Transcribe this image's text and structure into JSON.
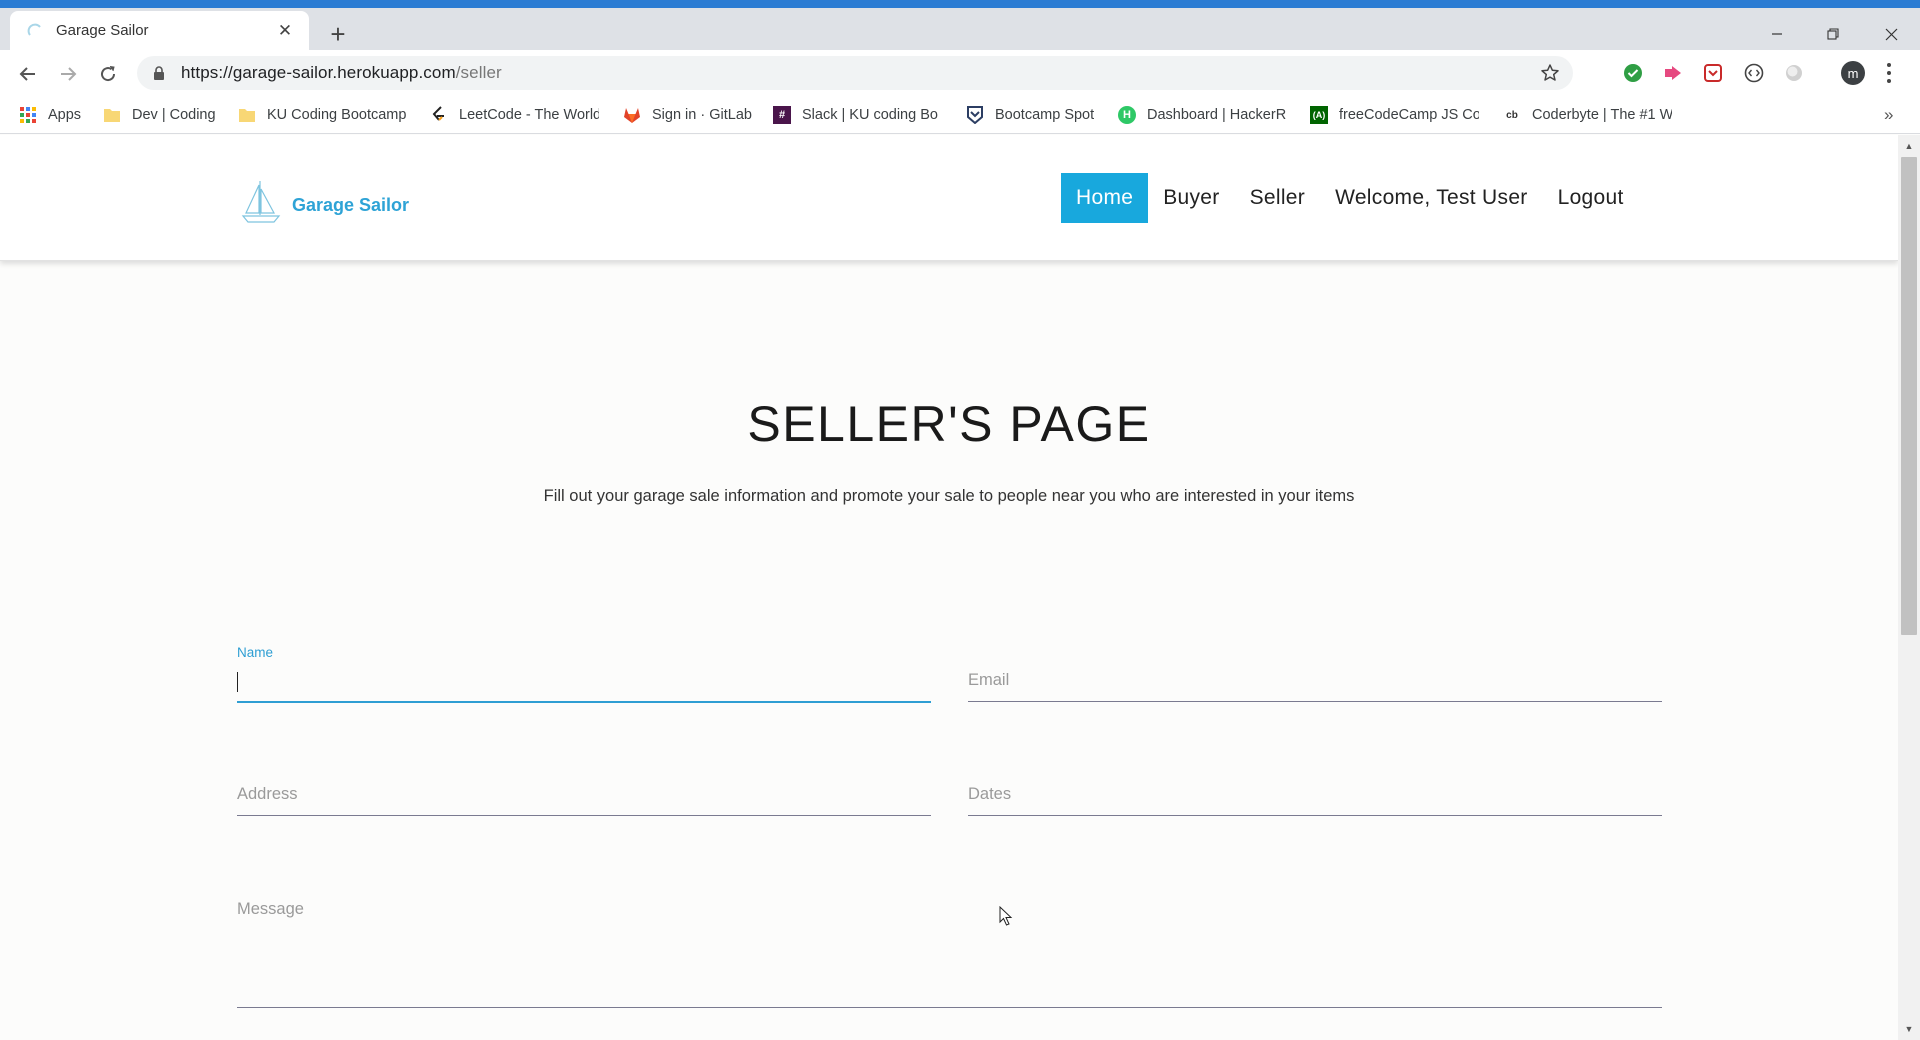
{
  "browser": {
    "tab_title": "Garage Sailor",
    "new_tab_symbol": "+",
    "close_symbol": "✕",
    "url_host": "https://garage-sailor.herokuapp.com",
    "url_path": "/seller",
    "profile_initial": "m",
    "bookmarks": [
      {
        "label": "Apps",
        "icon": "apps-grid-icon"
      },
      {
        "label": "Dev | Coding",
        "icon": "folder-icon"
      },
      {
        "label": "KU Coding Bootcamp",
        "icon": "folder-icon"
      },
      {
        "label": "LeetCode - The World",
        "icon": "leetcode-icon"
      },
      {
        "label": "Sign in · GitLab",
        "icon": "gitlab-icon"
      },
      {
        "label": "Slack | KU coding Bo",
        "icon": "slack-icon"
      },
      {
        "label": "Bootcamp Spot",
        "icon": "bootcamp-spot-icon"
      },
      {
        "label": "Dashboard | HackerR",
        "icon": "hackerrank-icon"
      },
      {
        "label": "freeCodeCamp JS Co",
        "icon": "freecodecamp-icon"
      },
      {
        "label": "Coderbyte | The #1 W",
        "icon": "coderbyte-icon"
      }
    ],
    "more_bookmarks_symbol": "»"
  },
  "site": {
    "brand_name": "Garage Sailor",
    "nav": [
      {
        "label": "Home",
        "active": true
      },
      {
        "label": "Buyer",
        "active": false
      },
      {
        "label": "Seller",
        "active": false
      },
      {
        "label": "Welcome, Test User",
        "active": false
      },
      {
        "label": "Logout",
        "active": false
      }
    ],
    "accent_color": "#18a8dd"
  },
  "page": {
    "title": "SELLER'S PAGE",
    "subtitle": "Fill out your garage sale information and promote your sale to people near you who are interested in your items"
  },
  "form": {
    "name_label": "Name",
    "name_value": "",
    "email_label": "Email",
    "address_label": "Address",
    "dates_label": "Dates",
    "message_label": "Message"
  }
}
